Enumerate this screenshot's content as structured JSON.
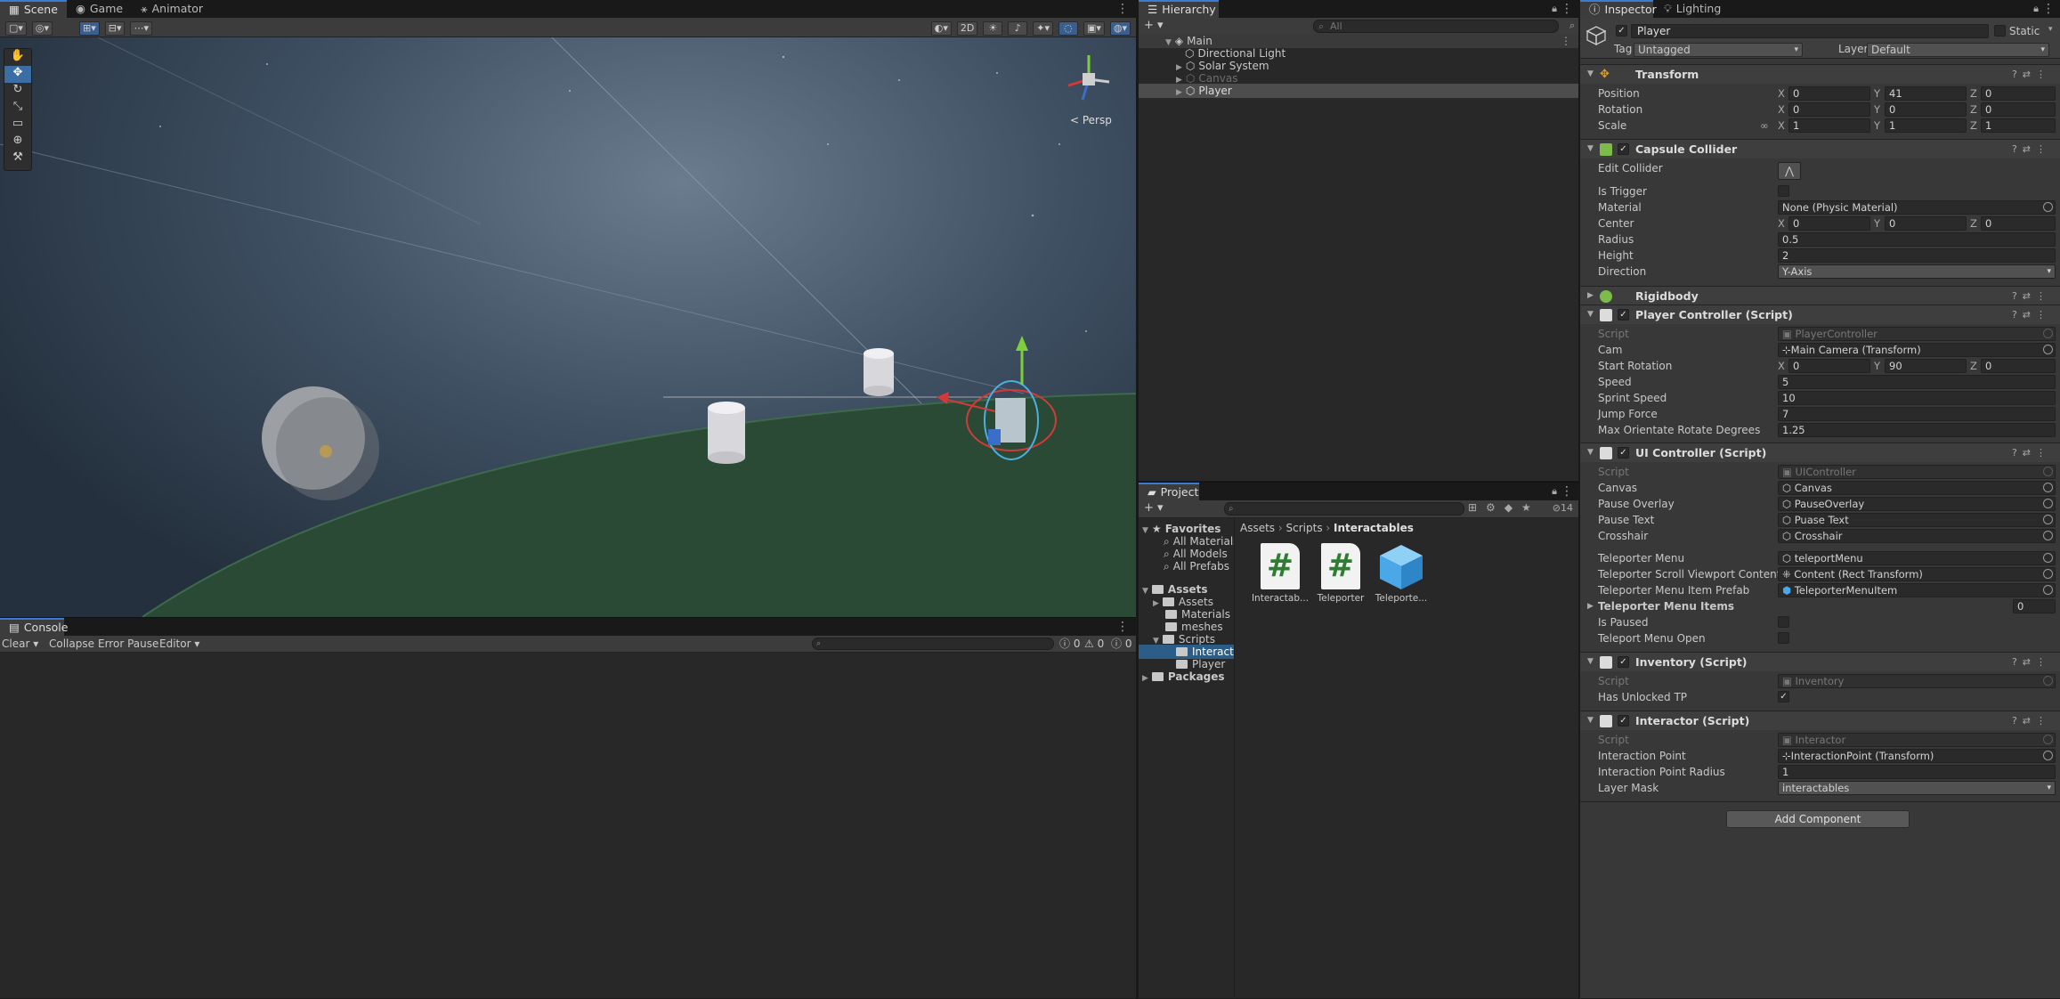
{
  "scene_tabs": [
    "Scene",
    "Game",
    "Animator"
  ],
  "scene_toolbar": {
    "mode_2d": "2D"
  },
  "persp_label": "< Persp",
  "hierarchy": {
    "tab": "Hierarchy",
    "search_placeholder": "All",
    "root": "Main",
    "items": [
      "Directional Light",
      "Solar System",
      "Canvas",
      "Player"
    ]
  },
  "inspector": {
    "tabs": [
      "Inspector",
      "Lighting"
    ],
    "object_name": "Player",
    "static_label": "Static",
    "tag_label": "Tag",
    "tag_value": "Untagged",
    "layer_label": "Layer",
    "layer_value": "Default",
    "transform": {
      "title": "Transform",
      "rows": [
        {
          "label": "Position",
          "x": "0",
          "y": "41",
          "z": "0"
        },
        {
          "label": "Rotation",
          "x": "0",
          "y": "0",
          "z": "0"
        },
        {
          "label": "Scale",
          "x": "1",
          "y": "1",
          "z": "1"
        }
      ]
    },
    "capsule": {
      "title": "Capsule Collider",
      "edit_collider": "Edit Collider",
      "is_trigger": "Is Trigger",
      "material_label": "Material",
      "material_value": "None (Physic Material)",
      "center_label": "Center",
      "center": {
        "x": "0",
        "y": "0",
        "z": "0"
      },
      "radius_label": "Radius",
      "radius": "0.5",
      "height_label": "Height",
      "height": "2",
      "direction_label": "Direction",
      "direction": "Y-Axis"
    },
    "rigidbody": {
      "title": "Rigidbody"
    },
    "player_controller": {
      "title": "Player Controller (Script)",
      "script_label": "Script",
      "script": "PlayerController",
      "cam_label": "Cam",
      "cam": "Main Camera (Transform)",
      "start_rotation_label": "Start Rotation",
      "start_rotation": {
        "x": "0",
        "y": "90",
        "z": "0"
      },
      "speed_label": "Speed",
      "speed": "5",
      "sprint_label": "Sprint Speed",
      "sprint": "10",
      "jump_label": "Jump Force",
      "jump": "7",
      "orient_label": "Max Orientate Rotate Degrees",
      "orient": "1.25"
    },
    "ui_controller": {
      "title": "UI Controller (Script)",
      "script_label": "Script",
      "script": "UIController",
      "canvas_label": "Canvas",
      "canvas": "Canvas",
      "pause_overlay_label": "Pause Overlay",
      "pause_overlay": "PauseOverlay",
      "pause_text_label": "Pause Text",
      "pause_text": "Puase Text",
      "crosshair_label": "Crosshair",
      "crosshair": "Crosshair",
      "tp_menu_label": "Teleporter Menu",
      "tp_menu": "teleportMenu",
      "tp_scroll_label": "Teleporter Scroll Viewport Content",
      "tp_scroll": "Content (Rect Transform)",
      "tp_prefab_label": "Teleporter Menu Item Prefab",
      "tp_prefab": "TeleporterMenuItem",
      "tp_items_label": "Teleporter Menu Items",
      "tp_items": "0",
      "is_paused_label": "Is Paused",
      "tp_open_label": "Teleport Menu Open"
    },
    "inventory": {
      "title": "Inventory (Script)",
      "script_label": "Script",
      "script": "Inventory",
      "unlocked_label": "Has Unlocked TP"
    },
    "interactor": {
      "title": "Interactor (Script)",
      "script_label": "Script",
      "script": "Interactor",
      "point_label": "Interaction Point",
      "point": "InteractionPoint (Transform)",
      "radius_label": "Interaction Point Radius",
      "radius": "1",
      "mask_label": "Layer Mask",
      "mask": "interactables"
    },
    "add_component": "Add Component"
  },
  "project": {
    "tab": "Project",
    "hidden_count": "14",
    "favorites": "Favorites",
    "fav_items": [
      "All Materials",
      "All Models",
      "All Prefabs"
    ],
    "assets": "Assets",
    "asset_folders": [
      "Assets",
      "Materials",
      "meshes",
      "Scripts"
    ],
    "script_folders": [
      "Interactab",
      "Player"
    ],
    "packages": "Packages",
    "breadcrumb": [
      "Assets",
      "Scripts",
      "Interactables"
    ],
    "files": [
      "Interactab...",
      "Teleporter",
      "Teleporte..."
    ]
  },
  "console": {
    "tab": "Console",
    "clear": "Clear",
    "collapse": "Collapse",
    "error_pause": "Error Pause",
    "editor": "Editor",
    "counts": [
      "0",
      "0",
      "0"
    ]
  },
  "colors": {
    "accent": "#3a7bd5",
    "ground": "#2b4a36",
    "hash_green": "#2f7d32",
    "prefab_blue": "#4aa8e8"
  }
}
